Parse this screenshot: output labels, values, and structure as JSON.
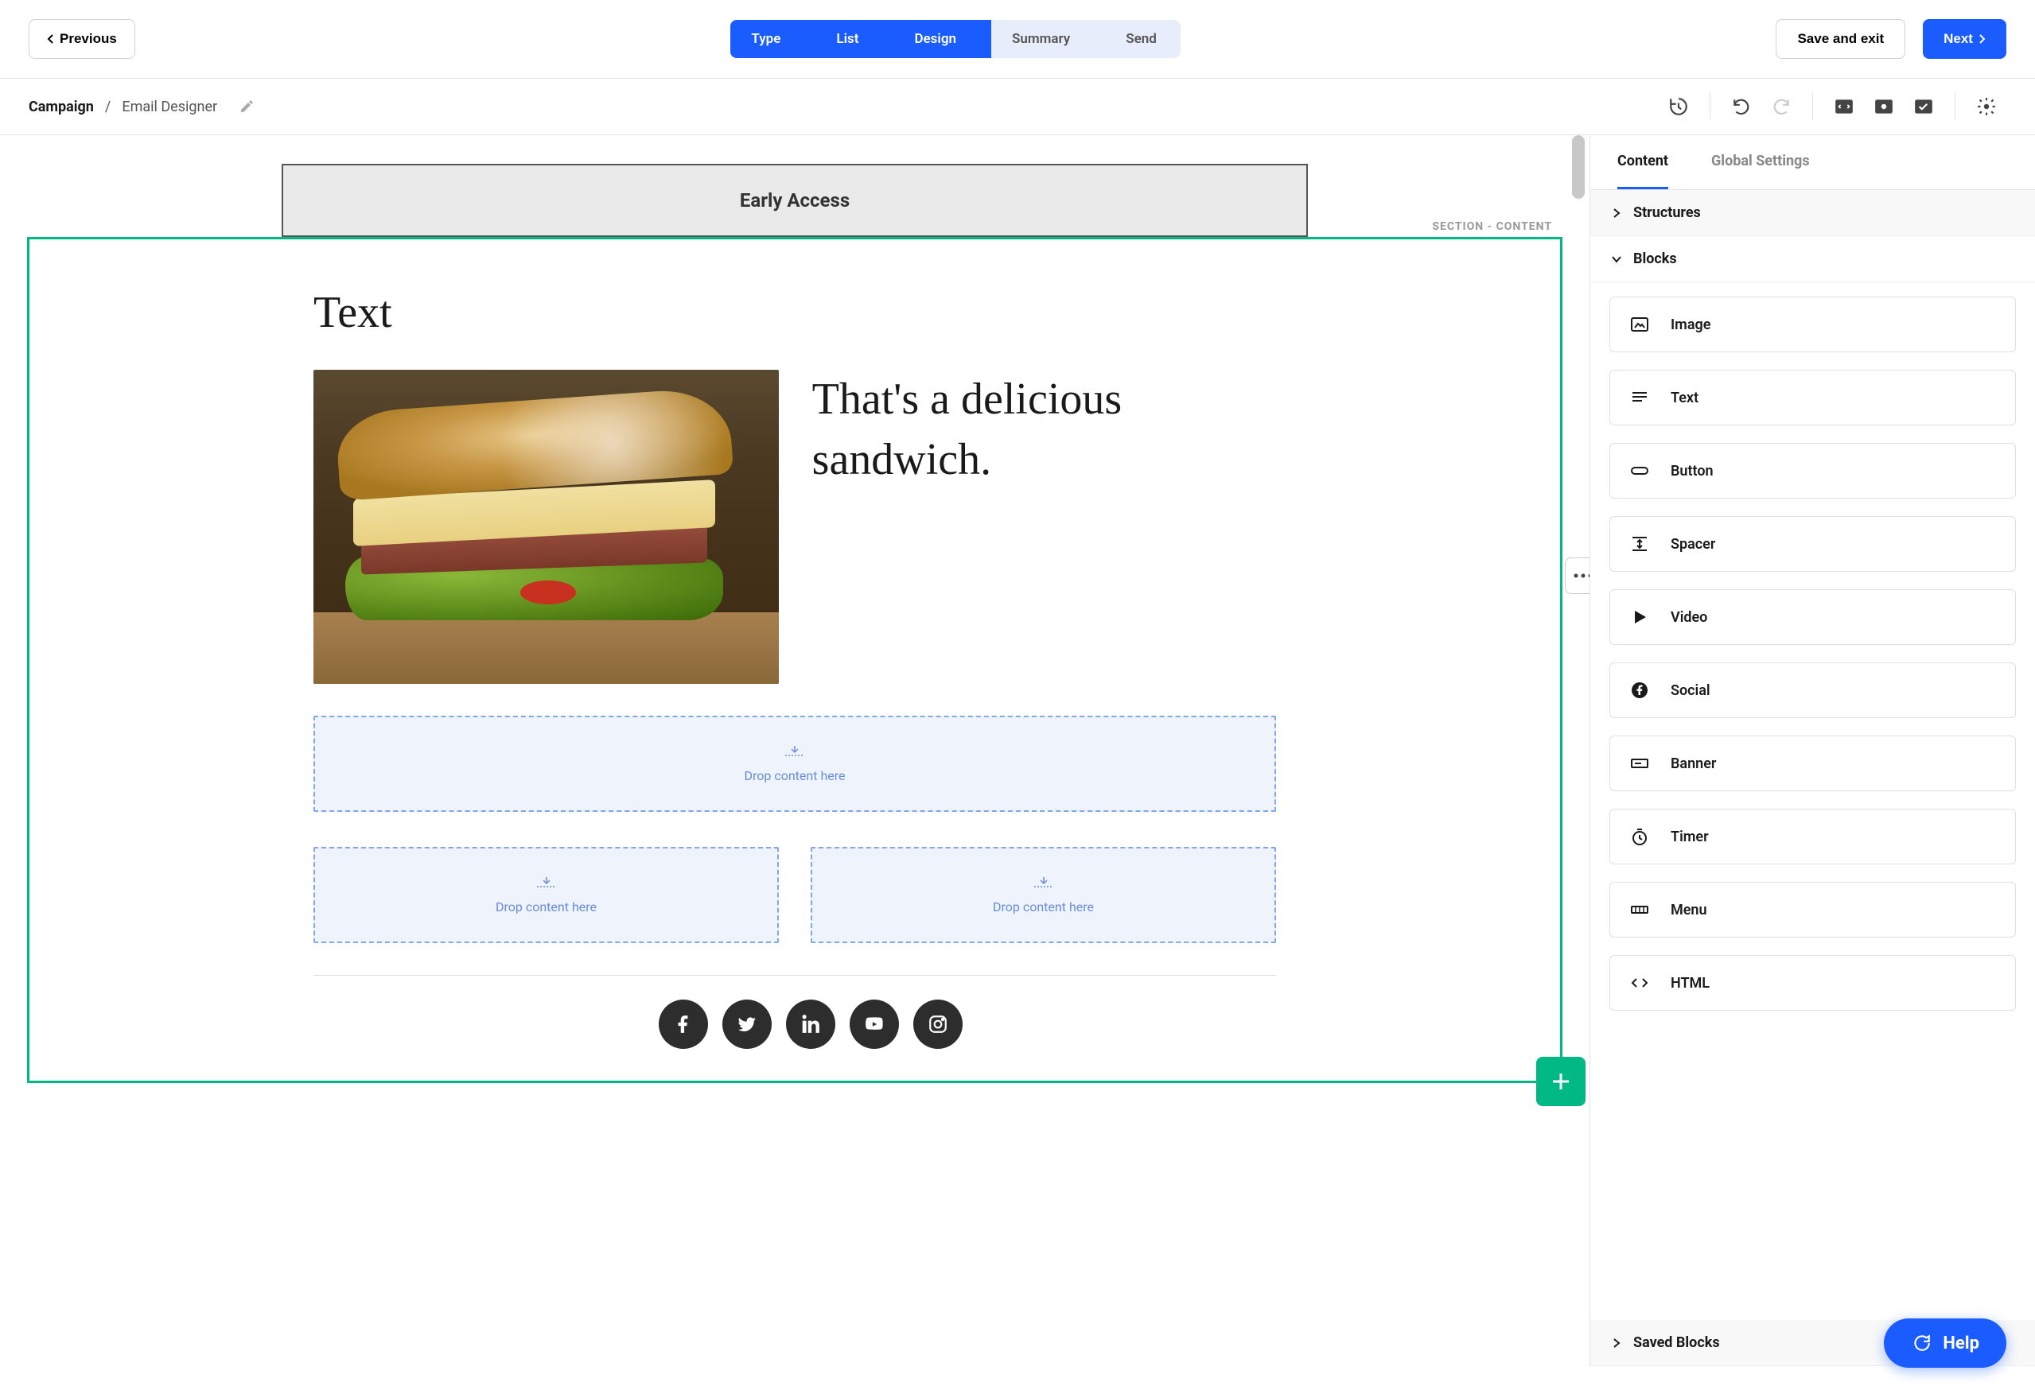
{
  "topbar": {
    "previous": "Previous",
    "save_exit": "Save and exit",
    "next": "Next",
    "steps": [
      "Type",
      "List",
      "Design",
      "Summary",
      "Send"
    ]
  },
  "breadcrumb": {
    "root": "Campaign",
    "sep": "/",
    "leaf": "Email Designer"
  },
  "canvas": {
    "banner_title": "Early Access",
    "section_label": "SECTION - CONTENT",
    "text_heading": "Text",
    "caption": "That's a delicious sandwich.",
    "drop_hint": "Drop content here"
  },
  "sidebar": {
    "tabs": {
      "content": "Content",
      "global": "Global Settings"
    },
    "accordion": {
      "structures": "Structures",
      "blocks": "Blocks",
      "saved": "Saved Blocks"
    },
    "blocks": [
      "Image",
      "Text",
      "Button",
      "Spacer",
      "Video",
      "Social",
      "Banner",
      "Timer",
      "Menu",
      "HTML"
    ]
  },
  "help": {
    "label": "Help"
  }
}
